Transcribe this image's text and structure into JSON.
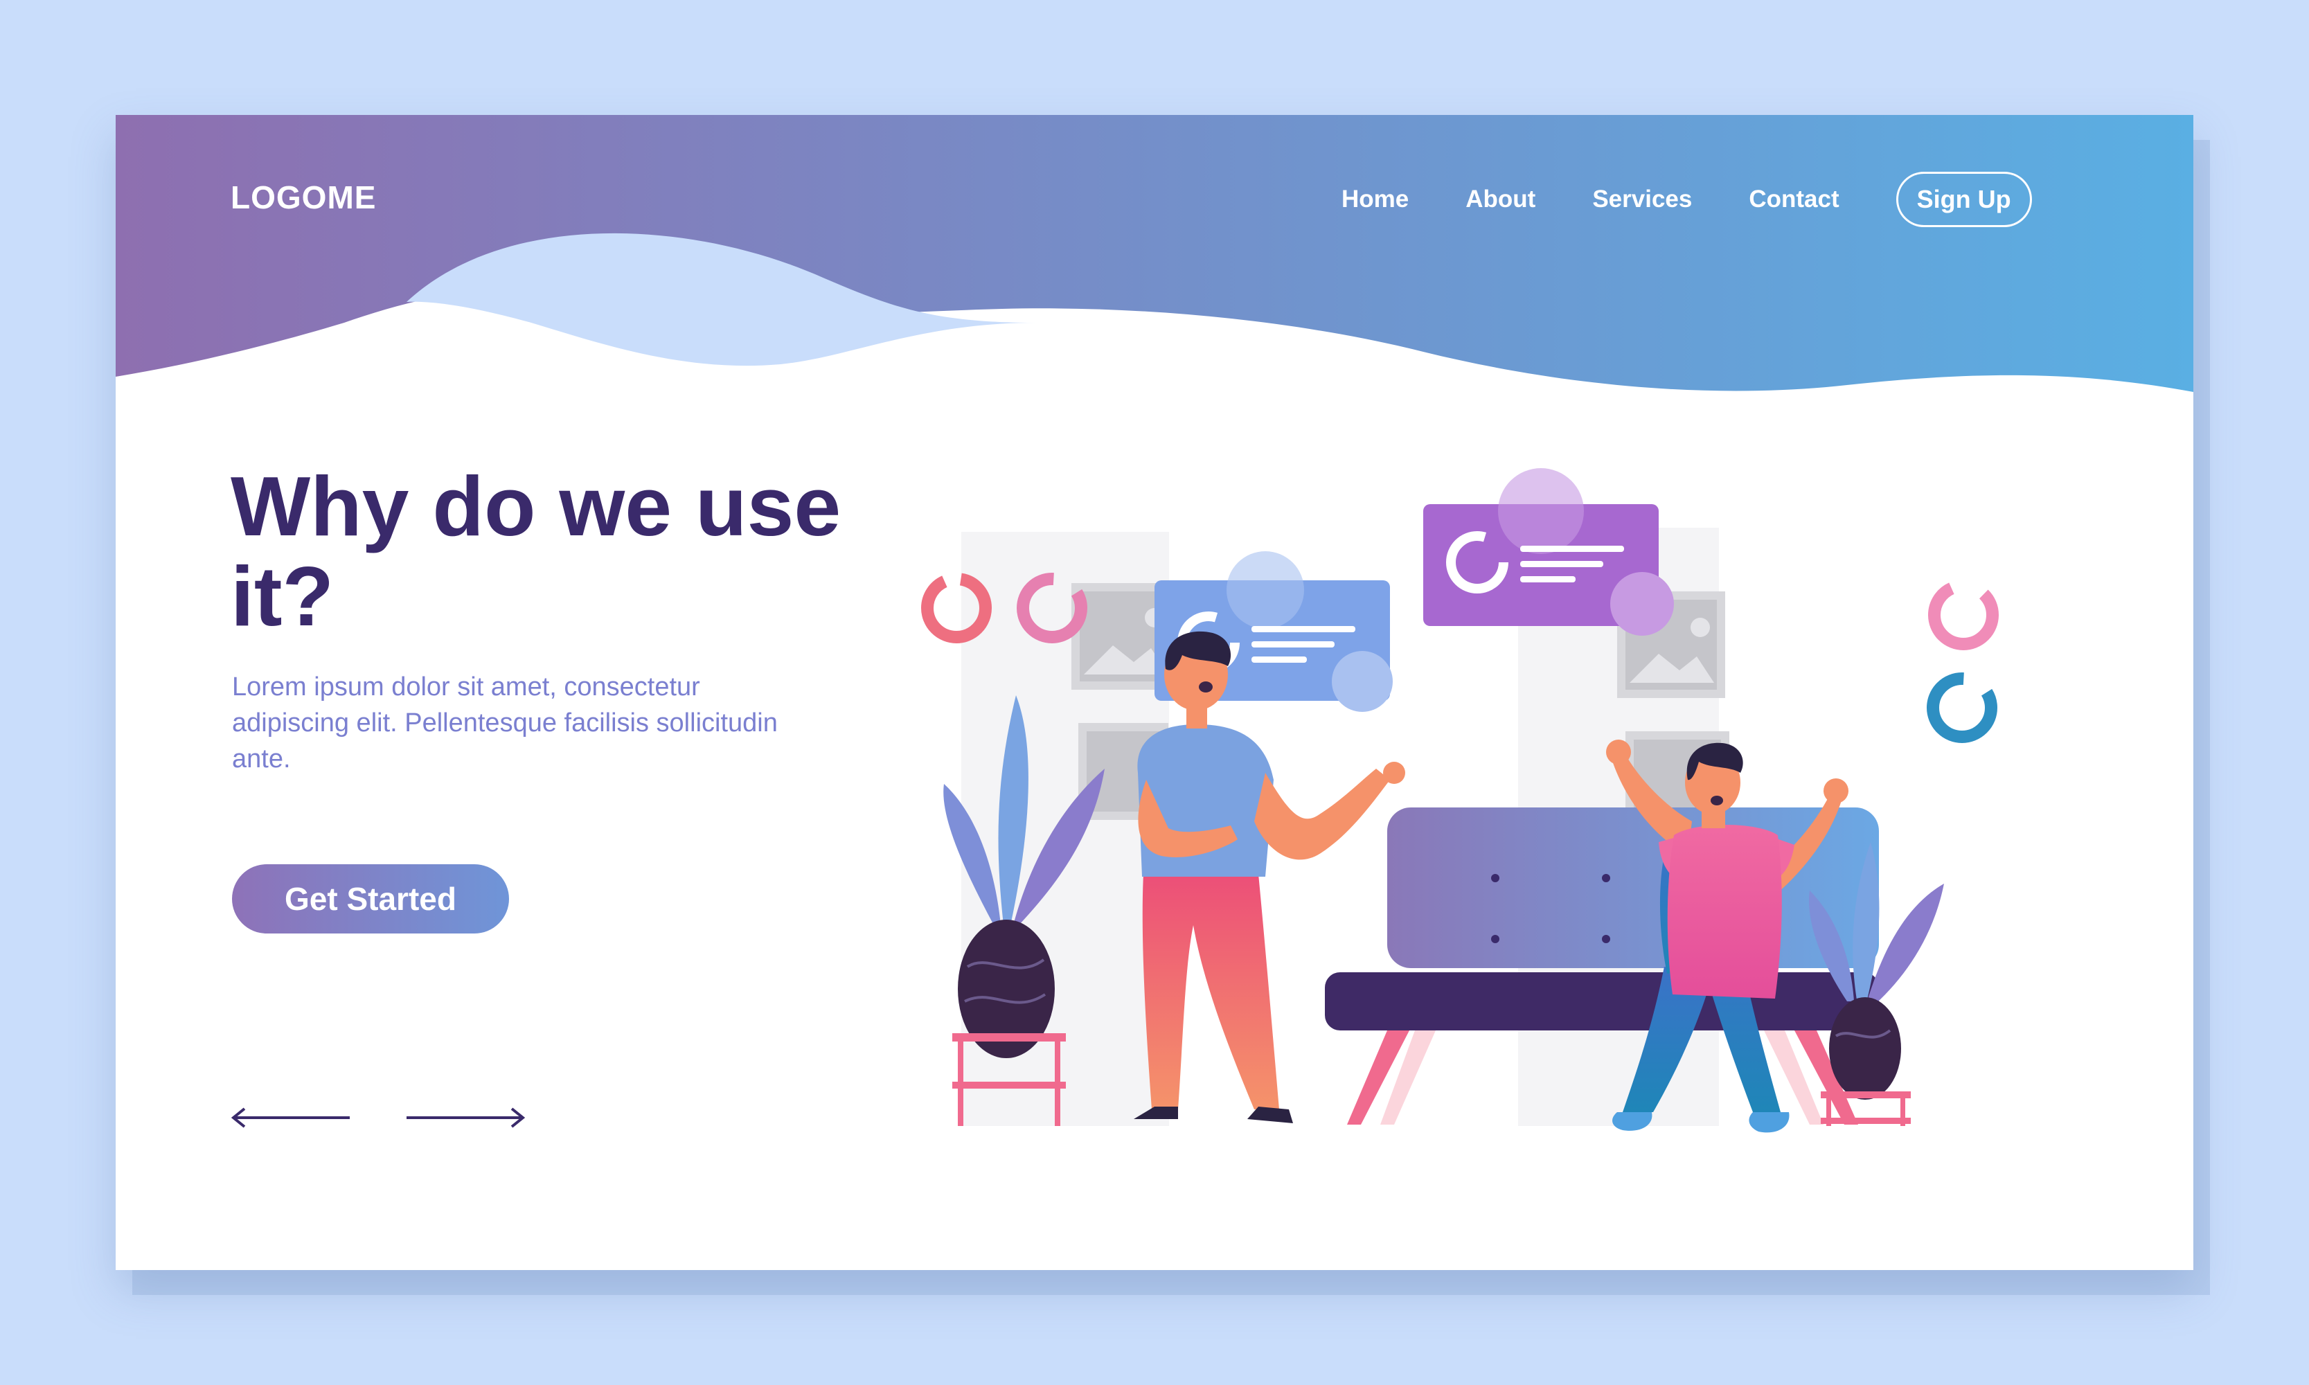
{
  "brand": {
    "logo_text": "LOGOME"
  },
  "nav": {
    "items": [
      {
        "label": "Home"
      },
      {
        "label": "About"
      },
      {
        "label": "Services"
      },
      {
        "label": "Contact"
      }
    ],
    "signup_label": "Sign Up"
  },
  "hero": {
    "title": "Why do we use it?",
    "description": "Lorem ipsum dolor sit amet, consectetur adipiscing elit. Pellentesque facilisis sollicitudin ante.",
    "cta_label": "Get Started"
  },
  "carousel": {
    "prev_icon": "arrow-left-icon",
    "next_icon": "arrow-right-icon"
  },
  "colors": {
    "page_bg": "#c9ddfb",
    "header_gradient_start": "#8e6fb0",
    "header_gradient_end": "#5aafe3",
    "heading": "#3a2a6b",
    "body_text": "#7a7fd0"
  }
}
